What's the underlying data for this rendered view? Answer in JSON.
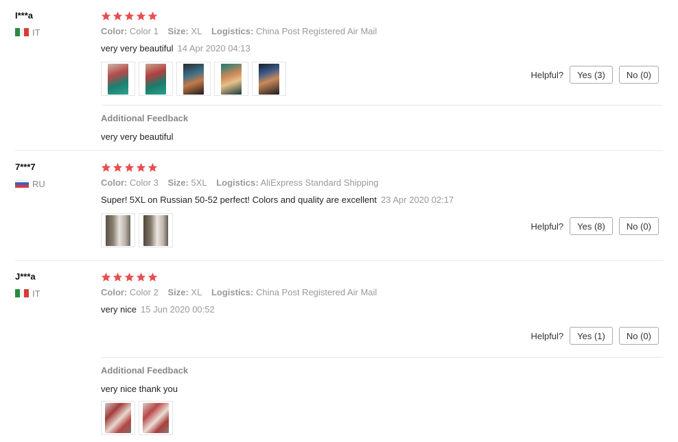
{
  "colors": {
    "star": "#e84e4e",
    "label": "#999999",
    "border": "#e8e8e8"
  },
  "helpful_label": "Helpful?",
  "meta_labels": {
    "color": "Color:",
    "size": "Size:",
    "logistics": "Logistics:"
  },
  "additional_feedback_title": "Additional Feedback",
  "reviews": [
    {
      "user": "I***a",
      "country": "IT",
      "flag": "italy-flag",
      "rating": 5,
      "color": "Color 1",
      "size": "XL",
      "logistics": "China Post Registered Air Mail",
      "text": "very very beautiful",
      "date": "14 Apr 2020 04:13",
      "photos": 5,
      "yes": "Yes (3)",
      "no": "No (0)",
      "additional_feedback": "very very beautiful"
    },
    {
      "user": "7***7",
      "country": "RU",
      "flag": "russia-flag",
      "rating": 5,
      "color": "Color 3",
      "size": "5XL",
      "logistics": "AliExpress Standard Shipping",
      "text": "Super! 5XL on Russian 50-52 perfect! Colors and quality are excellent",
      "date": "23 Apr 2020 02:17",
      "photos": 2,
      "yes": "Yes (8)",
      "no": "No (0)"
    },
    {
      "user": "J***a",
      "country": "IT",
      "flag": "italy-flag",
      "rating": 5,
      "color": "Color 2",
      "size": "XL",
      "logistics": "China Post Registered Air Mail",
      "text": "very nice",
      "date": "15 Jun 2020 00:52",
      "photos": 0,
      "yes": "Yes (1)",
      "no": "No (0)",
      "additional_feedback": "very nice thank you",
      "additional_photos": 2
    }
  ]
}
